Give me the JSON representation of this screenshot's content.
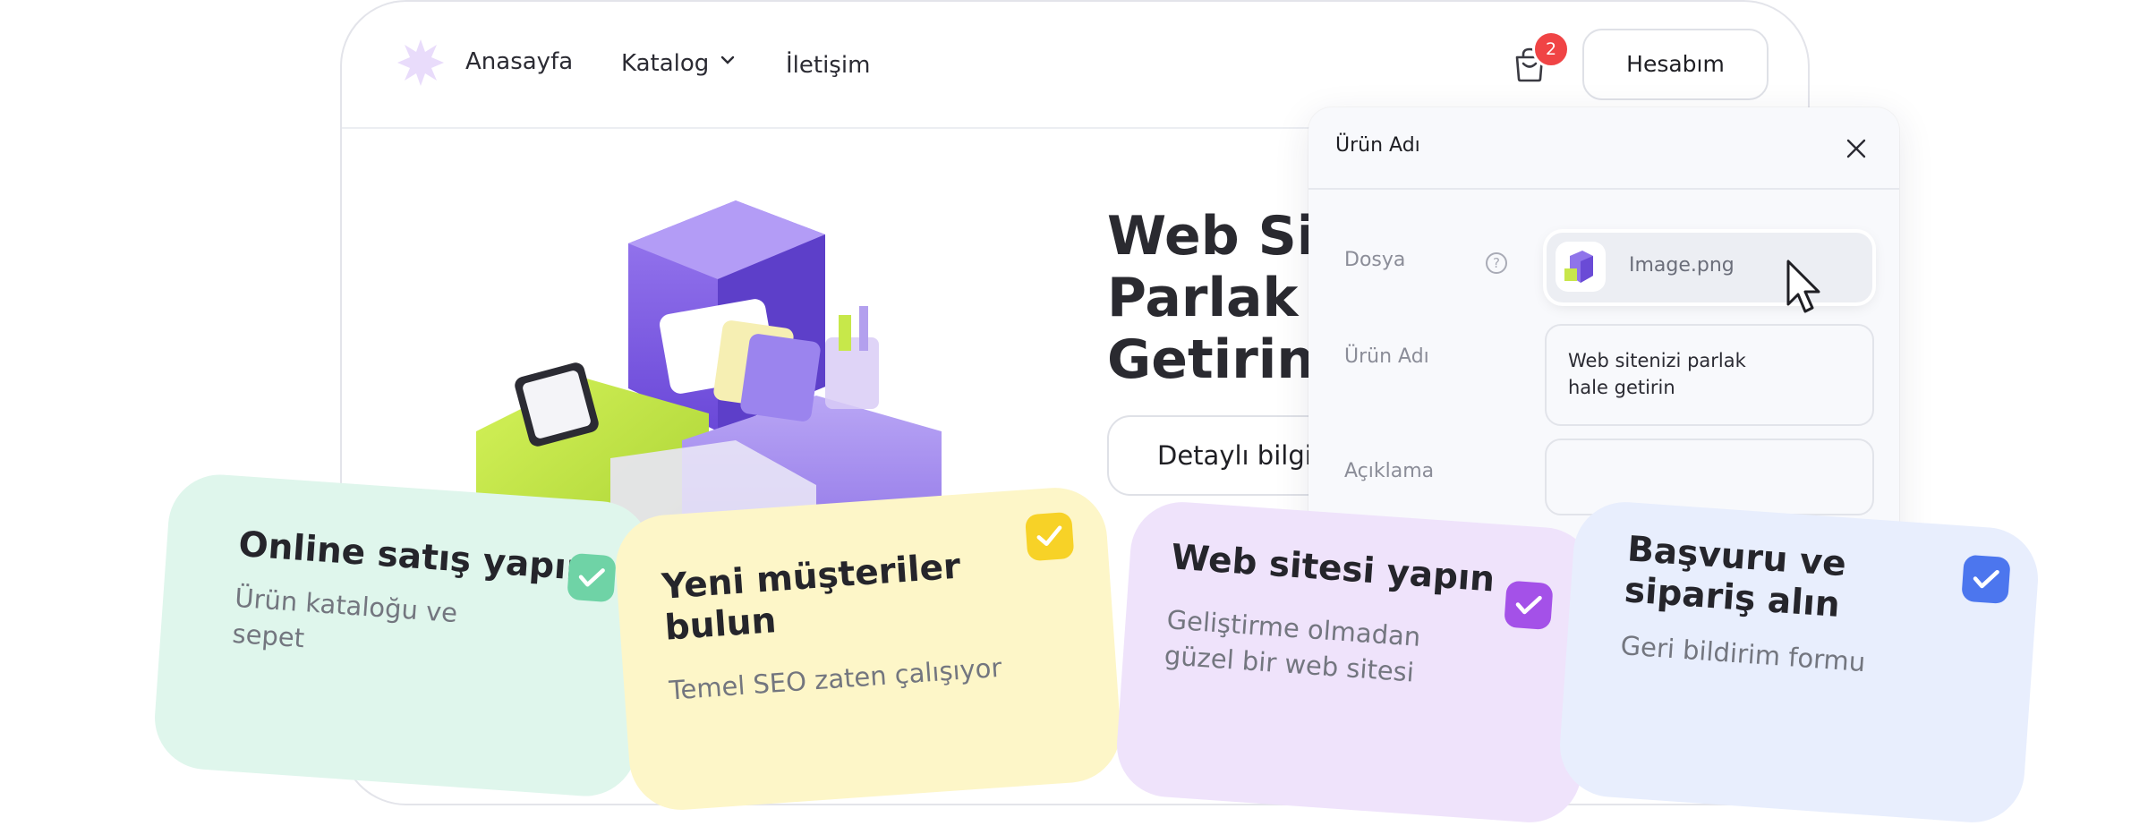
{
  "nav": {
    "links": [
      {
        "label": "Anasayfa"
      },
      {
        "label": "Katalog"
      },
      {
        "label": "İletişim"
      }
    ],
    "cart_count": "2",
    "account_label": "Hesabım"
  },
  "hero": {
    "title": "Web Site\nParlak H\nGetirin",
    "button_label": "Detaylı bilgi"
  },
  "panel": {
    "title": "Ürün Adı",
    "fields": {
      "file_label": "Dosya",
      "file_help": "?",
      "file_value": "Image.png",
      "name_label": "Ürün Adı",
      "name_value": "Web sitenizi parlak\nhale getirin",
      "description_label": "Açıklama",
      "description_value": ""
    }
  },
  "features": [
    {
      "title": "Online satış yapın",
      "subtitle": "Ürün kataloğu ve\nsepet",
      "color": "#dff6ec",
      "check_color": "#6fd3a6"
    },
    {
      "title": "Yeni müşteriler\nbulun",
      "subtitle": "Temel SEO zaten çalışıyor",
      "color": "#fdf6c8",
      "check_color": "#f7d227"
    },
    {
      "title": "Web sitesi yapın",
      "subtitle": "Geliştirme olmadan\ngüzel bir web sitesi",
      "color": "#efe3fb",
      "check_color": "#a451e8"
    },
    {
      "title": "Başvuru ve\nsipariş alın",
      "subtitle": "Geri bildirim formu",
      "color": "#e8eefd",
      "check_color": "#4c76ee"
    }
  ],
  "colors": {
    "accent_purple": "#8a6de6",
    "badge_red": "#f04445"
  }
}
